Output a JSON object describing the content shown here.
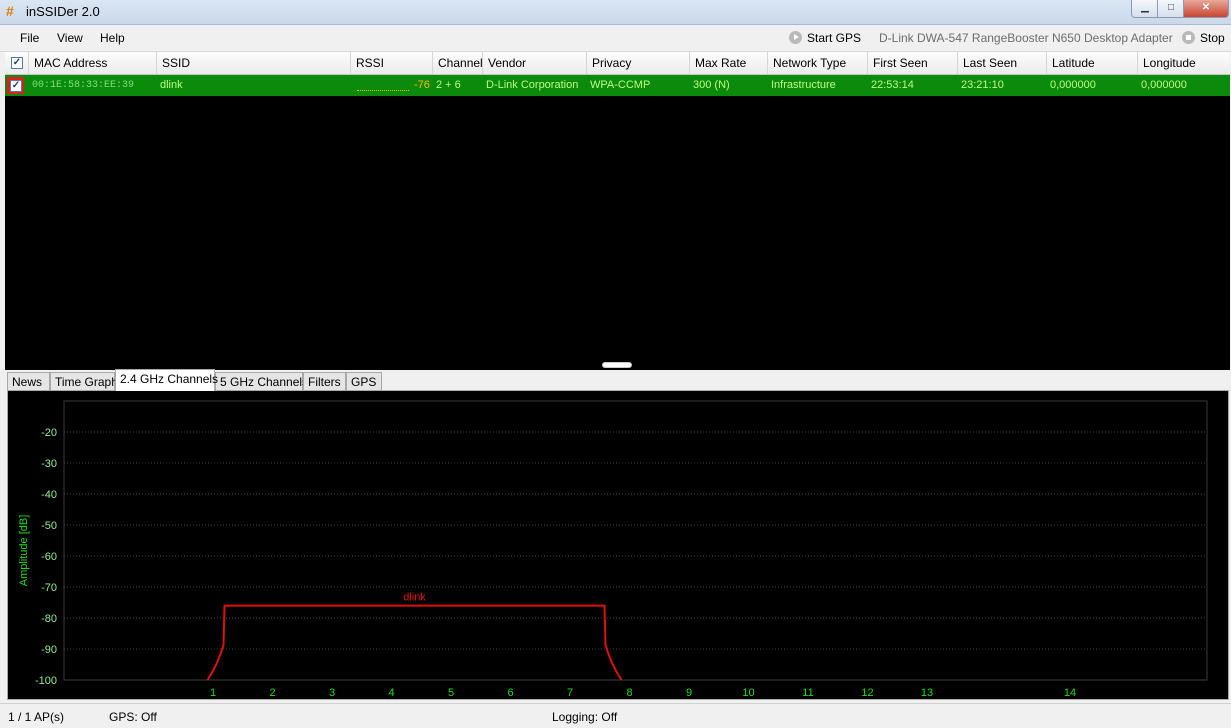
{
  "window": {
    "title": "inSSIDer 2.0",
    "app_icon": "#",
    "minimize": "▁",
    "maximize": "□",
    "close": "✕"
  },
  "menu": {
    "items": [
      "File",
      "View",
      "Help"
    ]
  },
  "gps": {
    "start_label": "Start GPS",
    "adapter": "D-Link DWA-547 RangeBooster N650 Desktop Adapter",
    "stop_label": "Stop"
  },
  "table": {
    "columns": [
      "MAC Address",
      "SSID",
      "RSSI",
      "Channel",
      "Vendor",
      "Privacy",
      "Max Rate",
      "Network Type",
      "First Seen",
      "Last Seen",
      "Latitude",
      "Longitude"
    ],
    "rows": [
      {
        "checked": true,
        "mac": "00:1E:58:33:EE:39",
        "ssid": "dlink",
        "rssi": "-76",
        "channel": "2 + 6",
        "vendor": "D-Link Corporation",
        "privacy": "WPA-CCMP",
        "max_rate": "300 (N)",
        "network_type": "Infrastructure",
        "first_seen": "22:53:14",
        "last_seen": "23:21:10",
        "latitude": "0,000000",
        "longitude": "0,000000"
      }
    ]
  },
  "tabs": [
    "News",
    "Time Graph",
    "2.4 GHz Channels",
    "5 GHz Channels",
    "Filters",
    "GPS"
  ],
  "active_tab": "2.4 GHz Channels",
  "chart_data": {
    "type": "line",
    "ylabel": "Amplitude [dB]",
    "yticks": [
      "-20",
      "-30",
      "-40",
      "-50",
      "-60",
      "-70",
      "-80",
      "-90",
      "-100"
    ],
    "ylim": [
      -100,
      -10
    ],
    "xticks": [
      "1",
      "2",
      "3",
      "4",
      "5",
      "6",
      "7",
      "8",
      "9",
      "10",
      "11",
      "12",
      "13",
      "14"
    ],
    "grid": true,
    "series": [
      {
        "name": "dlink",
        "color": "#e01010",
        "channel_start": 2,
        "channel_end": 6,
        "amplitude": -76
      }
    ]
  },
  "status": {
    "aps": "1 / 1 AP(s)",
    "gps": "GPS: Off",
    "logging": "Logging: Off"
  }
}
